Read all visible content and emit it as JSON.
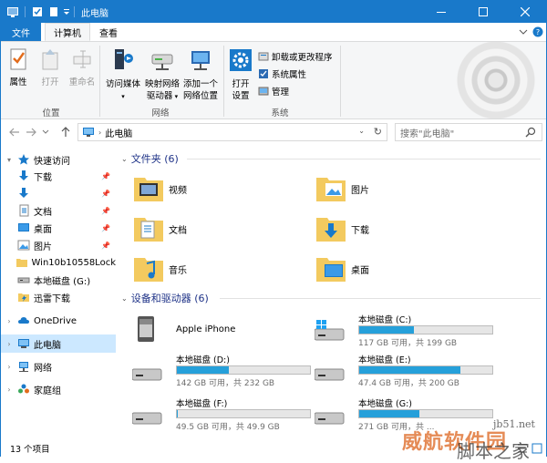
{
  "window": {
    "title": "此电脑"
  },
  "tabs": {
    "file": "文件",
    "computer": "计算机",
    "view": "查看"
  },
  "ribbon": {
    "location": {
      "label": "位置",
      "properties": "属性",
      "open": "打开",
      "rename": "重命名"
    },
    "network": {
      "label": "网络",
      "access_media": "访问媒体",
      "map_drive_1": "映射网络",
      "map_drive_2": "驱动器",
      "add_location_1": "添加一个",
      "add_location_2": "网络位置"
    },
    "system": {
      "label": "系统",
      "open_settings_1": "打开",
      "open_settings_2": "设置",
      "uninstall": "卸载或更改程序",
      "system_properties": "系统属性",
      "manage": "管理"
    }
  },
  "address": {
    "path": "此电脑",
    "search_placeholder": "搜索\"此电脑\""
  },
  "navpane": {
    "quick_access": "快速访问",
    "items": [
      {
        "label": "下载",
        "icon": "download-arrow-icon"
      },
      {
        "label": "",
        "icon": "download-arrow-icon"
      },
      {
        "label": "文档",
        "icon": "document-icon"
      },
      {
        "label": "桌面",
        "icon": "desktop-icon"
      },
      {
        "label": "图片",
        "icon": "pictures-icon"
      },
      {
        "label": "Win10b10558Lock",
        "icon": "folder-icon"
      },
      {
        "label": "本地磁盘 (G:)",
        "icon": "drive-icon"
      },
      {
        "label": "迅雷下载",
        "icon": "thunder-download-icon"
      }
    ],
    "onedrive": "OneDrive",
    "this_pc": "此电脑",
    "network": "网络",
    "homegroup": "家庭组"
  },
  "folders": {
    "header": "文件夹 (6)",
    "items": [
      {
        "label": "视频",
        "icon": "videos-folder-icon"
      },
      {
        "label": "图片",
        "icon": "pictures-folder-icon"
      },
      {
        "label": "文档",
        "icon": "documents-folder-icon"
      },
      {
        "label": "下载",
        "icon": "downloads-folder-icon"
      },
      {
        "label": "音乐",
        "icon": "music-folder-icon"
      },
      {
        "label": "桌面",
        "icon": "desktop-folder-icon"
      }
    ]
  },
  "devices": {
    "header": "设备和驱动器 (6)",
    "iphone": "Apple iPhone",
    "drives": [
      {
        "name": "本地磁盘 (C:)",
        "info": "117 GB 可用，共 199 GB",
        "used_fraction": 0.41
      },
      {
        "name": "本地磁盘 (D:)",
        "info": "142 GB 可用，共 232 GB",
        "used_fraction": 0.39
      },
      {
        "name": "本地磁盘 (E:)",
        "info": "47.4 GB 可用，共 200 GB",
        "used_fraction": 0.76
      },
      {
        "name": "本地磁盘 (F:)",
        "info": "49.5 GB 可用，共 49.9 GB",
        "used_fraction": 0.01
      },
      {
        "name": "本地磁盘 (G:)",
        "info": "271 GB 可用，共 ...",
        "used_fraction": 0.45
      }
    ]
  },
  "status": {
    "count": "13 个项目"
  },
  "watermark": {
    "site": "jb51.net",
    "brand": "威航软件园",
    "sub": "脚本之家"
  },
  "colors": {
    "accent": "#1979ca",
    "drive_fill": "#26a0da",
    "folder": "#f3ca5f",
    "selected": "#cce8ff"
  }
}
